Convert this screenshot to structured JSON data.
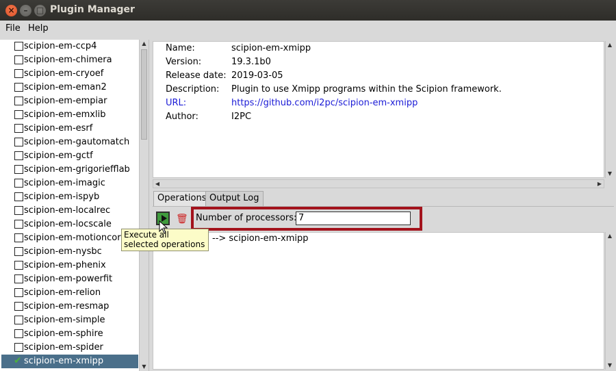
{
  "window": {
    "title": "Plugin Manager"
  },
  "menu": {
    "file": "File",
    "help": "Help"
  },
  "plugins": [
    {
      "name": "scipion-em-ccp4",
      "checked": false
    },
    {
      "name": "scipion-em-chimera",
      "checked": false
    },
    {
      "name": "scipion-em-cryoef",
      "checked": false
    },
    {
      "name": "scipion-em-eman2",
      "checked": false
    },
    {
      "name": "scipion-em-empiar",
      "checked": false
    },
    {
      "name": "scipion-em-emxlib",
      "checked": false
    },
    {
      "name": "scipion-em-esrf",
      "checked": false
    },
    {
      "name": "scipion-em-gautomatch",
      "checked": false
    },
    {
      "name": "scipion-em-gctf",
      "checked": false
    },
    {
      "name": "scipion-em-grigoriefflab",
      "checked": false
    },
    {
      "name": "scipion-em-imagic",
      "checked": false
    },
    {
      "name": "scipion-em-ispyb",
      "checked": false
    },
    {
      "name": "scipion-em-localrec",
      "checked": false
    },
    {
      "name": "scipion-em-locscale",
      "checked": false
    },
    {
      "name": "scipion-em-motioncorr",
      "checked": false
    },
    {
      "name": "scipion-em-nysbc",
      "checked": false
    },
    {
      "name": "scipion-em-phenix",
      "checked": false
    },
    {
      "name": "scipion-em-powerfit",
      "checked": false
    },
    {
      "name": "scipion-em-relion",
      "checked": false
    },
    {
      "name": "scipion-em-resmap",
      "checked": false
    },
    {
      "name": "scipion-em-simple",
      "checked": false
    },
    {
      "name": "scipion-em-sphire",
      "checked": false
    },
    {
      "name": "scipion-em-spider",
      "checked": false
    },
    {
      "name": "scipion-em-xmipp",
      "checked": true,
      "selected": true
    }
  ],
  "info": {
    "name_key": "Name:",
    "name_val": "scipion-em-xmipp",
    "version_key": "Version:",
    "version_val": "19.3.1b0",
    "release_key": "Release date:",
    "release_val": "2019-03-05",
    "desc_key": "Description:",
    "desc_val": "Plugin to use Xmipp programs within the Scipion framework.",
    "url_key": "URL:",
    "url_val": "https://github.com/i2pc/scipion-em-xmipp",
    "author_key": "Author:",
    "author_val": "I2PC"
  },
  "tabs": {
    "operations": "Operations",
    "output_log": "Output Log"
  },
  "operations": {
    "processors_label": "Number of processors:",
    "processors_value": "7",
    "op_line": "--> scipion-em-xmipp"
  },
  "tooltip": {
    "text": "Execute all selected operations"
  },
  "colors": {
    "selection": "#4a6f8a",
    "highlight_border": "#a3131c",
    "link": "#1a1ad6",
    "play_green": "#3f9b3d",
    "tooltip_bg": "#fcfcc8"
  }
}
